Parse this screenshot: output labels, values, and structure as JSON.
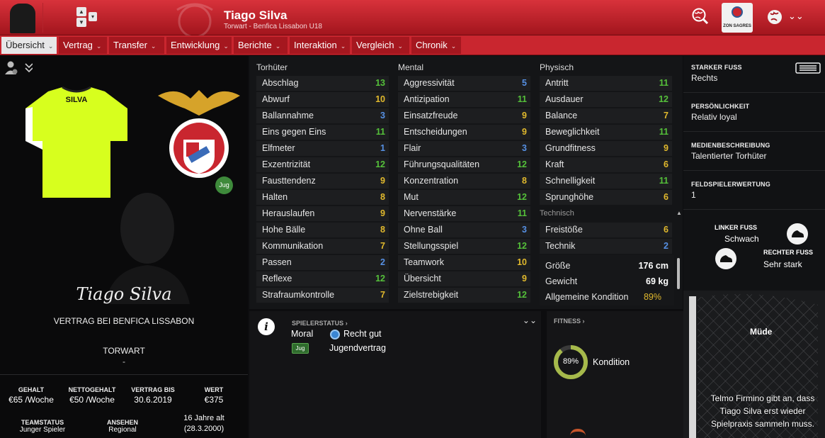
{
  "header": {
    "player_name": "Tiago Silva",
    "subtitle": "Torwart - Benfica Lissabon U18",
    "sponsor_badge": "ZON SAGRES"
  },
  "tabs": [
    {
      "label": "Übersicht",
      "active": true
    },
    {
      "label": "Vertrag"
    },
    {
      "label": "Transfer"
    },
    {
      "label": "Entwicklung"
    },
    {
      "label": "Berichte"
    },
    {
      "label": "Interaktion"
    },
    {
      "label": "Vergleich"
    },
    {
      "label": "Chronik"
    }
  ],
  "profile": {
    "shirt_name": "SILVA",
    "youth_badge": "Jug",
    "signature_name": "Tiago Silva",
    "contract_text": "VERTRAG BEI BENFICA LISSABON",
    "position": "TORWART",
    "position_sub": "-",
    "stats": {
      "gehalt_label": "GEHALT",
      "gehalt_value": "€65 /Woche",
      "netto_label": "NETTOGEHALT",
      "netto_value": "€50 /Woche",
      "vertrag_label": "VERTRAG BIS",
      "vertrag_value": "30.6.2019",
      "wert_label": "WERT",
      "wert_value": "€375",
      "teamstatus_label": "TEAMSTATUS",
      "teamstatus_value": "Junger Spieler",
      "ansehen_label": "ANSEHEN",
      "ansehen_value": "Regional",
      "age_value": "16 Jahre alt",
      "birth_value": "(28.3.2000)"
    }
  },
  "attributes": {
    "torhueter_title": "Torhüter",
    "mental_title": "Mental",
    "physisch_title": "Physisch",
    "technisch_title": "Technisch",
    "torhueter": [
      {
        "name": "Abschlag",
        "value": "13",
        "c": "g"
      },
      {
        "name": "Abwurf",
        "value": "10",
        "c": "y"
      },
      {
        "name": "Ballannahme",
        "value": "3",
        "c": "b"
      },
      {
        "name": "Eins gegen Eins",
        "value": "11",
        "c": "g"
      },
      {
        "name": "Elfmeter",
        "value": "1",
        "c": "b"
      },
      {
        "name": "Exzentrizität",
        "value": "12",
        "c": "g"
      },
      {
        "name": "Fausttendenz",
        "value": "9",
        "c": "y"
      },
      {
        "name": "Halten",
        "value": "8",
        "c": "y"
      },
      {
        "name": "Herauslaufen",
        "value": "9",
        "c": "y"
      },
      {
        "name": "Hohe Bälle",
        "value": "8",
        "c": "y"
      },
      {
        "name": "Kommunikation",
        "value": "7",
        "c": "y"
      },
      {
        "name": "Passen",
        "value": "2",
        "c": "b"
      },
      {
        "name": "Reflexe",
        "value": "12",
        "c": "g"
      },
      {
        "name": "Strafraumkontrolle",
        "value": "7",
        "c": "y"
      }
    ],
    "mental": [
      {
        "name": "Aggressivität",
        "value": "5",
        "c": "b"
      },
      {
        "name": "Antizipation",
        "value": "11",
        "c": "g"
      },
      {
        "name": "Einsatzfreude",
        "value": "9",
        "c": "y"
      },
      {
        "name": "Entscheidungen",
        "value": "9",
        "c": "y"
      },
      {
        "name": "Flair",
        "value": "3",
        "c": "b"
      },
      {
        "name": "Führungsqualitäten",
        "value": "12",
        "c": "g"
      },
      {
        "name": "Konzentration",
        "value": "8",
        "c": "y"
      },
      {
        "name": "Mut",
        "value": "12",
        "c": "g"
      },
      {
        "name": "Nervenstärke",
        "value": "11",
        "c": "g"
      },
      {
        "name": "Ohne Ball",
        "value": "3",
        "c": "b"
      },
      {
        "name": "Stellungsspiel",
        "value": "12",
        "c": "g"
      },
      {
        "name": "Teamwork",
        "value": "10",
        "c": "y"
      },
      {
        "name": "Übersicht",
        "value": "9",
        "c": "y"
      },
      {
        "name": "Zielstrebigkeit",
        "value": "12",
        "c": "g"
      }
    ],
    "physisch": [
      {
        "name": "Antritt",
        "value": "11",
        "c": "g"
      },
      {
        "name": "Ausdauer",
        "value": "12",
        "c": "g"
      },
      {
        "name": "Balance",
        "value": "7",
        "c": "y"
      },
      {
        "name": "Beweglichkeit",
        "value": "11",
        "c": "g"
      },
      {
        "name": "Grundfitness",
        "value": "9",
        "c": "y"
      },
      {
        "name": "Kraft",
        "value": "6",
        "c": "y"
      },
      {
        "name": "Schnelligkeit",
        "value": "11",
        "c": "g"
      },
      {
        "name": "Sprunghöhe",
        "value": "6",
        "c": "y"
      }
    ],
    "technisch": [
      {
        "name": "Freistöße",
        "value": "6",
        "c": "y"
      },
      {
        "name": "Technik",
        "value": "2",
        "c": "b"
      }
    ],
    "body": {
      "groesse_label": "Größe",
      "groesse_value": "176 cm",
      "gewicht_label": "Gewicht",
      "gewicht_value": "69 kg",
      "kondition_label": "Allgemeine Kondition",
      "kondition_value": "89%"
    }
  },
  "status": {
    "title": "SPIELERSTATUS",
    "moral_label": "Moral",
    "moral_value": "Recht gut",
    "youth_badge": "Jug",
    "contract_value": "Jugendvertrag"
  },
  "fitness": {
    "title": "FITNESS",
    "percent_text": "89%",
    "percent": 89,
    "label": "Kondition"
  },
  "right": {
    "starker_fuss_label": "STARKER FUSS",
    "starker_fuss_value": "Rechts",
    "persoenlichkeit_label": "PERSÖNLICHKEIT",
    "persoenlichkeit_value": "Relativ loyal",
    "medien_label": "MEDIENBESCHREIBUNG",
    "medien_value": "Talentierter Torhüter",
    "feldspieler_label": "FELDSPIELERWERTUNG",
    "feldspieler_value": "1",
    "linker_label": "LINKER FUSS",
    "linker_value": "Schwach",
    "rechter_label": "RECHTER FUSS",
    "rechter_value": "Sehr stark",
    "muede_label": "Müde",
    "news_text": "Telmo Firmino gibt an, dass Tiago Silva erst wieder Spielpraxis sammeln muss."
  },
  "colors": {
    "brand_red": "#c9262f",
    "green": "#55c13a",
    "yellow": "#e1b92d",
    "blue": "#5690e3",
    "shirt": "#d7ff1e"
  }
}
